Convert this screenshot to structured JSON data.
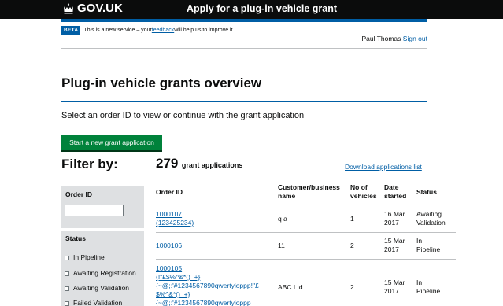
{
  "header": {
    "logo_text": "GOV.UK",
    "service_name": "Apply for a plug-in vehicle grant"
  },
  "beta": {
    "tag": "BETA",
    "text_before": "This is a new service – your ",
    "feedback_link": "feedback",
    "text_after": " will help us to improve it."
  },
  "user": {
    "name": "Paul Thomas",
    "sign_out": "Sign out"
  },
  "page": {
    "title": "Plug-in vehicle grants overview",
    "lead": "Select an order ID to view or continue with the grant application",
    "start_button": "Start a new grant application"
  },
  "filter": {
    "title": "Filter by:",
    "order_id_label": "Order ID",
    "order_id_value": "",
    "status_label": "Status",
    "statuses": [
      "In Pipeline",
      "Awaiting Registration",
      "Awaiting Validation",
      "Failed Validation"
    ]
  },
  "results": {
    "count": "279",
    "count_label": "grant applications",
    "download": "Download applications list"
  },
  "table": {
    "headers": {
      "order_id": "Order ID",
      "customer_l1": "Customer/business",
      "customer_l2": "name",
      "vehicles_l1": "No of",
      "vehicles_l2": "vehicles",
      "date_l1": "Date",
      "date_l2": "started",
      "status": "Status"
    },
    "rows": [
      {
        "order_id": "1000107",
        "order_ref": "(123425234)",
        "customer": "q a",
        "vehicles": "1",
        "date_l1": "16 Mar",
        "date_l2": "2017",
        "status_l1": "Awaiting",
        "status_l2": "Validation"
      },
      {
        "order_id": "1000106",
        "order_ref": "",
        "customer": "11",
        "vehicles": "2",
        "date_l1": "15 Mar",
        "date_l2": "2017",
        "status_l1": "In",
        "status_l2": "Pipeline"
      },
      {
        "order_id": "1000105",
        "order_ref_1": "(!\"£$%^&*()_+}",
        "order_ref_2": "{~@;:'#1234567890qwertyioppp!\"£",
        "order_ref_3": "$%^&*()_+}",
        "order_ref_4": "{~@;:'#1234567890qwertyioppp",
        "customer": "ABC Ltd",
        "vehicles": "2",
        "date_l1": "15 Mar",
        "date_l2": "2017",
        "status_l1": "In",
        "status_l2": "Pipeline"
      }
    ]
  },
  "colors": {
    "header_bg": "#0b0c0c",
    "brand_blue": "#005ea5",
    "button_green": "#00823b",
    "panel_grey": "#dee0e2"
  }
}
